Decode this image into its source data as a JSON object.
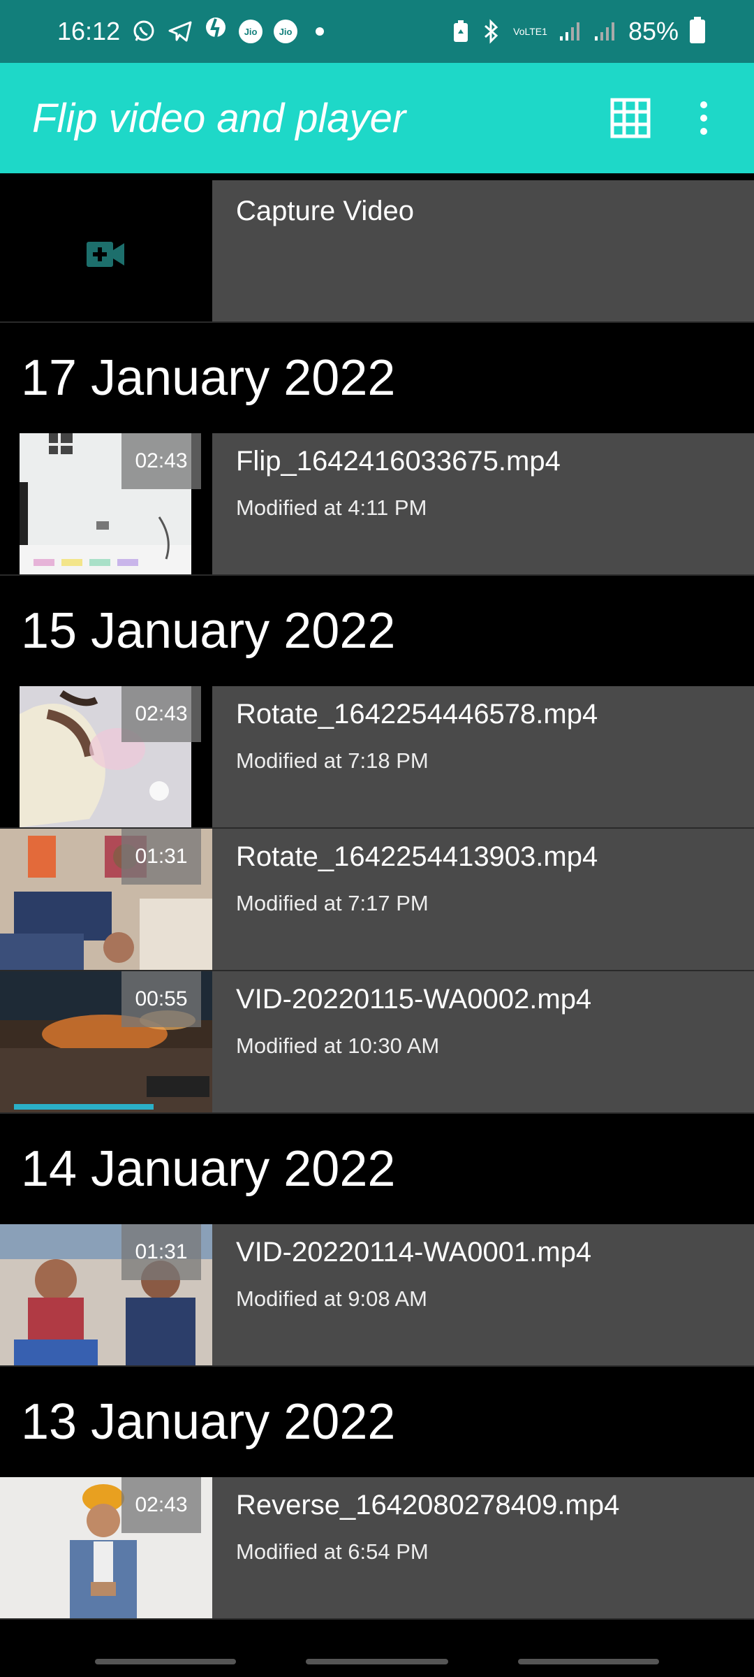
{
  "status_bar": {
    "time": "16:12",
    "battery_percent": "85%",
    "jio1": "Jio",
    "jio2": "Jio",
    "network": "VoLTE1"
  },
  "app_bar": {
    "title": "Flip video and player"
  },
  "capture": {
    "label": "Capture Video"
  },
  "groups": [
    {
      "date": "17 January 2022",
      "items": [
        {
          "name": "Flip_1642416033675.mp4",
          "modified": "Modified at 4:11 PM",
          "duration": "02:43"
        }
      ]
    },
    {
      "date": "15 January 2022",
      "items": [
        {
          "name": "Rotate_1642254446578.mp4",
          "modified": "Modified at 7:18 PM",
          "duration": "02:43"
        },
        {
          "name": "Rotate_1642254413903.mp4",
          "modified": "Modified at 7:17 PM",
          "duration": "01:31"
        },
        {
          "name": "VID-20220115-WA0002.mp4",
          "modified": "Modified at 10:30 AM",
          "duration": "00:55"
        }
      ]
    },
    {
      "date": "14 January 2022",
      "items": [
        {
          "name": "VID-20220114-WA0001.mp4",
          "modified": "Modified at 9:08 AM",
          "duration": "01:31"
        }
      ]
    },
    {
      "date": "13 January 2022",
      "items": [
        {
          "name": "Reverse_1642080278409.mp4",
          "modified": "Modified at 6:54 PM",
          "duration": "02:43"
        }
      ]
    }
  ],
  "colors": {
    "status_bar": "#127f7b",
    "app_bar": "#1ed8c8",
    "row_bg": "#4a4a4a",
    "camera_icon": "#1d6f6c"
  }
}
